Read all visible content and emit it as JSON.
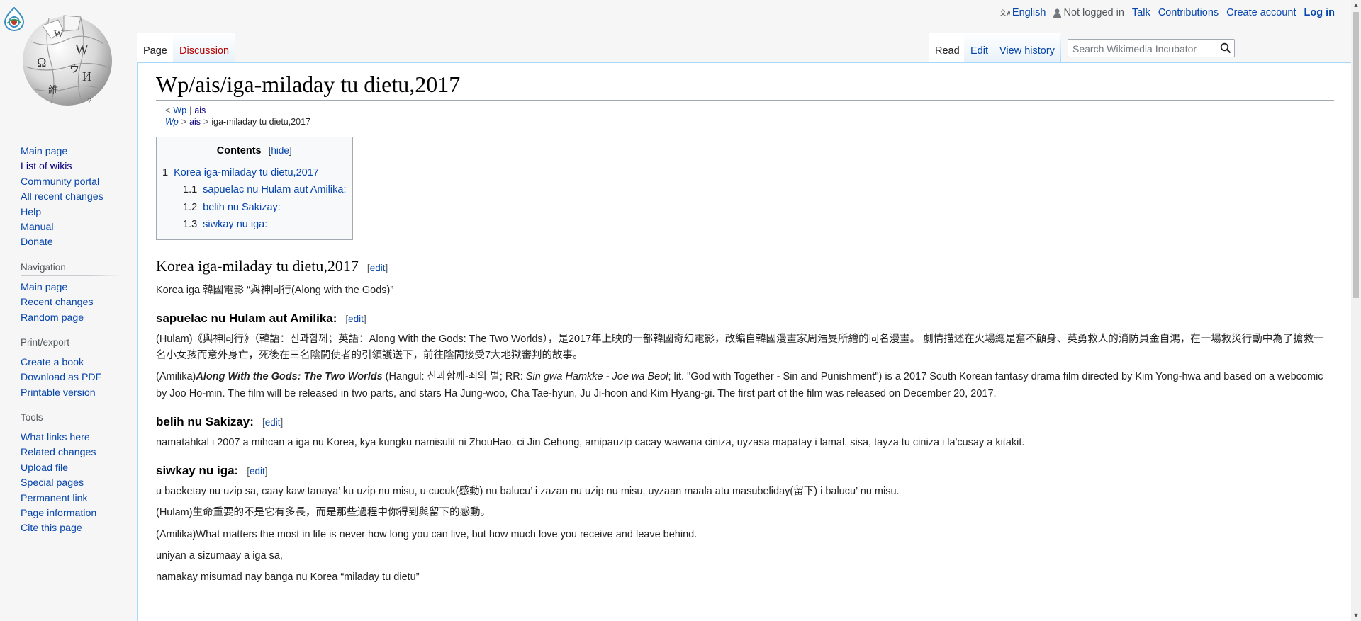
{
  "personal": {
    "language": "English",
    "not_logged_in": "Not logged in",
    "talk": "Talk",
    "contributions": "Contributions",
    "create_account": "Create account",
    "log_in": "Log in"
  },
  "tabs": {
    "page": "Page",
    "discussion": "Discussion",
    "read": "Read",
    "edit": "Edit",
    "view_history": "View history"
  },
  "search": {
    "placeholder": "Search Wikimedia Incubator"
  },
  "sidebar": {
    "main_items": [
      "Main page",
      "List of wikis",
      "Community portal",
      "All recent changes",
      "Help",
      "Manual",
      "Donate"
    ],
    "navigation": {
      "heading": "Navigation",
      "items": [
        "Main page",
        "Recent changes",
        "Random page"
      ]
    },
    "print_export": {
      "heading": "Print/export",
      "items": [
        "Create a book",
        "Download as PDF",
        "Printable version"
      ]
    },
    "tools": {
      "heading": "Tools",
      "items": [
        "What links here",
        "Related changes",
        "Upload file",
        "Special pages",
        "Permanent link",
        "Page information",
        "Cite this page"
      ]
    }
  },
  "page": {
    "title": "Wp/ais/iga-miladay tu dietu,2017",
    "subpages_line1": {
      "prefix": "<",
      "wp": "Wp",
      "sep": "|",
      "ais": "ais"
    },
    "breadcrumb": {
      "wp": "Wp",
      "sep1": ">",
      "ais": "ais",
      "sep2": ">",
      "current": "iga-miladay tu dietu,2017"
    }
  },
  "toc": {
    "title": "Contents",
    "hide": "hide",
    "items": [
      {
        "num": "1",
        "label": "Korea iga-miladay tu dietu,2017"
      },
      {
        "num": "1.1",
        "label": "sapuelac nu Hulam aut Amilika:"
      },
      {
        "num": "1.2",
        "label": "belih nu Sakizay:"
      },
      {
        "num": "1.3",
        "label": "siwkay nu iga:"
      }
    ]
  },
  "sections": {
    "edit_label": "edit",
    "s1": {
      "heading": "Korea iga-miladay tu dietu,2017",
      "p1": "Korea iga 韓國電影 “與神同行(Along with the Gods)”"
    },
    "s11": {
      "heading": "sapuelac nu Hulam aut Amilika:",
      "p1": "(Hulam)《與神同行》（韓語：신과함께；英語：Along With the Gods: The Two Worlds），是2017年上映的一部韓國奇幻電影，改編自韓國漫畫家周浩旻所繪的同名漫畫。 劇情描述在火場總是奮不顧身、英勇救人的消防員金自鴻，在一場救災行動中為了搶救一名小女孩而意外身亡，死後在三名陰間使者的引領護送下，前往陰間接受7大地獄審判的故事。",
      "p2_prefix": "(Amilika)",
      "p2_bold": "Along With the Gods: The Two Worlds",
      "p2_mid": " (Hangul: 신과함께-죄와 벌; RR: ",
      "p2_ital": "Sin gwa Hamkke - Joe wa Beol",
      "p2_rest": "; lit. \"God with Together - Sin and Punishment\") is a 2017 South Korean fantasy drama film directed by Kim Yong-hwa and based on a webcomic by Joo Ho-min. The film will be released in two parts, and stars Ha Jung-woo, Cha Tae-hyun, Ju Ji-hoon and Kim Hyang-gi. The first part of the film was released on December 20, 2017."
    },
    "s12": {
      "heading": "belih nu Sakizay:",
      "p1": "namatahkal i 2007 a mihcan a iga nu Korea, kya kungku namisulit ni ZhouHao. ci Jin Cehong, amipauzip cacay wawana ciniza, uyzasa mapatay i lamal. sisa, tayza tu ciniza i la'cusay a kitakit."
    },
    "s13": {
      "heading": "siwkay nu iga:",
      "p1": "u baeketay nu uzip sa, caay kaw tanaya’ ku uzip nu misu, u cucuk(感動) nu balucu’ i zazan nu uzip nu misu, uyzaan maala atu masubeliday(留下) i balucu’ nu misu.",
      "p2": "(Hulam)生命重要的不是它有多長，而是那些過程中你得到與留下的感動。",
      "p3": "(Amilika)What matters the most in life is never how long you can live, but how much love you receive and leave behind.",
      "p4": "uniyan a sizumaay a iga sa,",
      "p5": "namakay misumad nay banga nu Korea “miladay tu dietu”"
    }
  }
}
